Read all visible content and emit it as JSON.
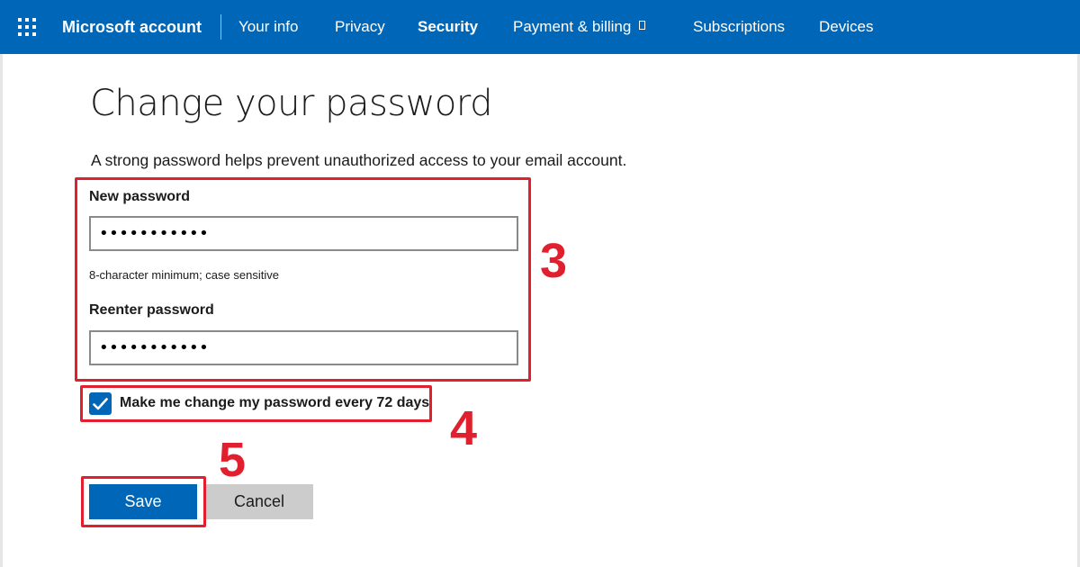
{
  "header": {
    "brand": "Microsoft account",
    "nav": [
      {
        "label": "Your info"
      },
      {
        "label": "Privacy"
      },
      {
        "label": "Security",
        "active": true
      },
      {
        "label": "Payment & billing",
        "external": true
      },
      {
        "label": "Subscriptions"
      },
      {
        "label": "Devices"
      }
    ],
    "brand_color": "#0067b8"
  },
  "main": {
    "title": "Change your password",
    "intro": "A strong password helps prevent unauthorized access to your email account.",
    "new_password": {
      "label": "New password",
      "value": "•••••••••••",
      "hint": "8-character minimum; case sensitive"
    },
    "reenter_password": {
      "label": "Reenter password",
      "value": "•••••••••••"
    },
    "expire_checkbox": {
      "checked": true,
      "label": "Make me change my password every 72 days"
    },
    "save_label": "Save",
    "cancel_label": "Cancel"
  },
  "annotations": {
    "color": "#e0202e",
    "step_passwords": "3",
    "step_checkbox": "4",
    "step_save": "5"
  }
}
